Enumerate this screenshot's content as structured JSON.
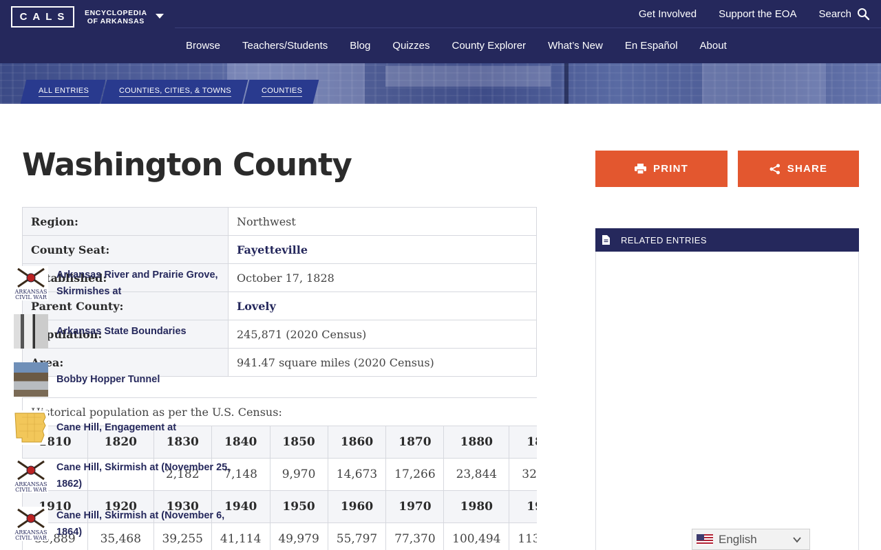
{
  "header": {
    "logo_text": "CALS",
    "site_name_line1": "ENCYCLOPEDIA",
    "site_name_line2": "OF ARKANSAS",
    "utility_links": [
      "Get Involved",
      "Support the EOA",
      "Search"
    ],
    "nav_items": [
      "Browse",
      "Teachers/Students",
      "Blog",
      "Quizzes",
      "County Explorer",
      "What’s New",
      "En Español",
      "About"
    ]
  },
  "breadcrumb": [
    "ALL ENTRIES",
    "COUNTIES, CITIES, & TOWNS",
    "COUNTIES"
  ],
  "page_title": "Washington County",
  "info": [
    {
      "label": "Region:",
      "value": "Northwest",
      "link": false
    },
    {
      "label": "County Seat:",
      "value": "Fayetteville",
      "link": true
    },
    {
      "label": "Established:",
      "value": "October 17, 1828",
      "link": false
    },
    {
      "label": "Parent County:",
      "value": "Lovely",
      "link": true
    },
    {
      "label": "Population:",
      "value": "245,871 (2020 Census)",
      "link": false
    },
    {
      "label": "Area:",
      "value": "941.47 square miles (2020 Census)",
      "link": false
    }
  ],
  "population": {
    "caption": "Historical population as per the U.S. Census:",
    "years_row1": [
      "1810",
      "1820",
      "1830",
      "1840",
      "1850",
      "1860",
      "1870",
      "1880",
      "18"
    ],
    "values_row1": [
      "",
      "",
      "2,182",
      "7,148",
      "9,970",
      "14,673",
      "17,266",
      "23,844",
      "32"
    ],
    "years_row2": [
      "1910",
      "1920",
      "1930",
      "1940",
      "1950",
      "1960",
      "1970",
      "1980",
      "19"
    ],
    "values_row2": [
      "33,889",
      "35,468",
      "39,255",
      "41,114",
      "49,979",
      "55,797",
      "77,370",
      "100,494",
      "113"
    ]
  },
  "actions": {
    "print_label": "PRINT",
    "share_label": "SHARE"
  },
  "related": {
    "header": "RELATED ENTRIES",
    "items": [
      {
        "title": "Arkansas River and Prairie Grove, Skirmishes at",
        "thumb": "civil-war-logo"
      },
      {
        "title": "Arkansas State Boundaries",
        "thumb": "photo"
      },
      {
        "title": "Bobby Hopper Tunnel",
        "thumb": "photo"
      },
      {
        "title": "Cane Hill, Engagement at",
        "thumb": "map"
      },
      {
        "title": "Cane Hill, Skirmish at (November 25, 1862)",
        "thumb": "civil-war-logo"
      },
      {
        "title": "Cane Hill, Skirmish at (November 6, 1864)",
        "thumb": "civil-war-logo"
      }
    ],
    "civil_war_logo_line1": "ARKANSAS",
    "civil_war_logo_line2": "CIVIL WAR"
  },
  "language": {
    "label": "English"
  },
  "colors": {
    "navy": "#25285c",
    "accent": "#e3572f",
    "crumb": "#293a8e"
  }
}
